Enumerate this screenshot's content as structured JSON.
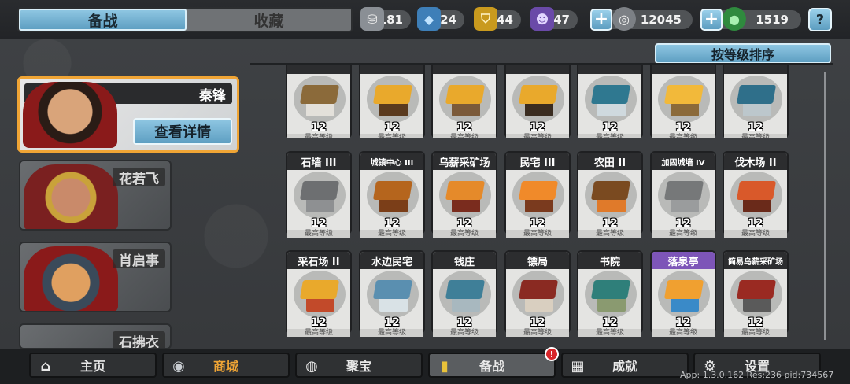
{
  "tabs": [
    {
      "label": "备战",
      "active": true
    },
    {
      "label": "收藏",
      "active": false
    }
  ],
  "currencies": [
    {
      "id": "silver-coin",
      "value": "3181",
      "color": "#c9cdd2",
      "glyph": "⛁"
    },
    {
      "id": "blue-gem",
      "value": "24",
      "color": "#5aa9e6",
      "glyph": "◆"
    },
    {
      "id": "gold-shield",
      "value": "44",
      "color": "#e9b528",
      "glyph": "⛉"
    },
    {
      "id": "purple-mask",
      "value": "47",
      "color": "#8c6bd1",
      "glyph": "☻"
    },
    {
      "id": "silver-money",
      "value": "12045",
      "color": "#d9dcdf",
      "glyph": "◎"
    },
    {
      "id": "jade",
      "value": "1519",
      "color": "#57c46a",
      "glyph": "●"
    }
  ],
  "help_label": "?",
  "sort_label": "按等级排序",
  "heroes": [
    {
      "name": "秦锋",
      "selected": true
    },
    {
      "name": "花若飞",
      "selected": false
    },
    {
      "name": "肖启事",
      "selected": false
    },
    {
      "name": "石拂衣",
      "selected": false
    }
  ],
  "detail_button": "查看详情",
  "max_level_text": "最高等级",
  "buildings_row0": [
    {
      "name": "",
      "level": "12",
      "roof": "#8b6a3a",
      "wall": "#e3e0da"
    },
    {
      "name": "",
      "level": "12",
      "roof": "#e9a92c",
      "wall": "#5a3a1e"
    },
    {
      "name": "",
      "level": "12",
      "roof": "#e9a92c",
      "wall": "#7b5a3a"
    },
    {
      "name": "",
      "level": "12",
      "roof": "#e9a92c",
      "wall": "#3a2c20"
    },
    {
      "name": "",
      "level": "12",
      "roof": "#2f7890",
      "wall": "#cfd9de"
    },
    {
      "name": "",
      "level": "12",
      "roof": "#f2b93a",
      "wall": "#8b6a3a"
    },
    {
      "name": "",
      "level": "12",
      "roof": "#2f6f8a",
      "wall": "#bcc7cc"
    }
  ],
  "buildings_row1": [
    {
      "name": "石墙 III",
      "level": "12",
      "roof": "#6d6f71",
      "wall": "#8e9092"
    },
    {
      "name": "城镇中心 III",
      "level": "12",
      "roof": "#b5651d",
      "wall": "#7b3e18"
    },
    {
      "name": "乌薪采矿场",
      "level": "12",
      "roof": "#e58a2a",
      "wall": "#7a2c1e"
    },
    {
      "name": "民宅 III",
      "level": "12",
      "roof": "#f08a2a",
      "wall": "#7a3a1e"
    },
    {
      "name": "农田 II",
      "level": "12",
      "roof": "#7a4a20",
      "wall": "#e07a2a"
    },
    {
      "name": "加固城墙 IV",
      "level": "12",
      "roof": "#767879",
      "wall": "#9a9c9d"
    },
    {
      "name": "伐木场 II",
      "level": "12",
      "roof": "#d9592a",
      "wall": "#6a2a1a"
    }
  ],
  "buildings_row2": [
    {
      "name": "采石场 II",
      "level": "12",
      "roof": "#e9a92c",
      "wall": "#c24a2a",
      "purple": false
    },
    {
      "name": "水边民宅",
      "level": "12",
      "roof": "#5a8fb0",
      "wall": "#d9e2e6",
      "purple": false
    },
    {
      "name": "钱庄",
      "level": "12",
      "roof": "#3f7f98",
      "wall": "#a8b8bf",
      "purple": false
    },
    {
      "name": "镖局",
      "level": "12",
      "roof": "#8a2a22",
      "wall": "#d9cfc0",
      "purple": false
    },
    {
      "name": "书院",
      "level": "12",
      "roof": "#2f7f7a",
      "wall": "#8a9a70",
      "purple": false
    },
    {
      "name": "落泉亭",
      "level": "12",
      "roof": "#f0a030",
      "wall": "#3a8ac8",
      "purple": true
    },
    {
      "name": "简易乌薪采矿场",
      "level": "12",
      "roof": "#9a2a22",
      "wall": "#5a5a5a",
      "purple": false
    }
  ],
  "nav": [
    {
      "id": "home",
      "label": "主页",
      "glyph": "⌂"
    },
    {
      "id": "shop",
      "label": "商城",
      "glyph": "◉"
    },
    {
      "id": "treasure",
      "label": "聚宝",
      "glyph": "◍"
    },
    {
      "id": "prepare",
      "label": "备战",
      "glyph": "▮"
    },
    {
      "id": "achievement",
      "label": "成就",
      "glyph": "▦"
    },
    {
      "id": "settings",
      "label": "设置",
      "glyph": "⚙"
    }
  ],
  "badge": "!",
  "app_info": "App: 1.3.0.162 Res:236 pid:734567"
}
